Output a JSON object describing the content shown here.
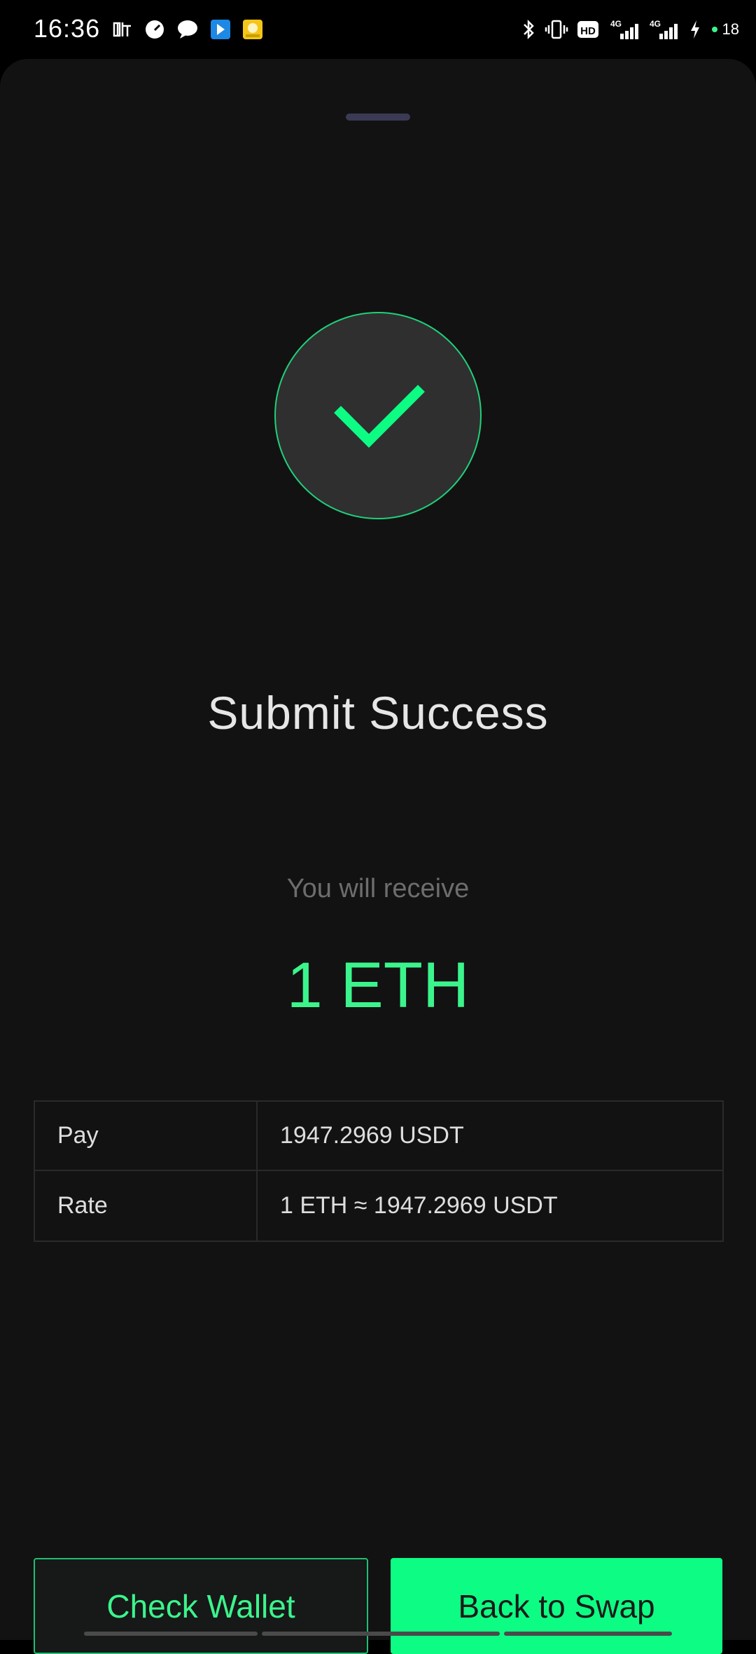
{
  "status_bar": {
    "time": "16:36",
    "battery": "18",
    "network_1": "4G",
    "network_2": "4G",
    "hd_label": "HD"
  },
  "main": {
    "title": "Submit Success",
    "receive_label": "You will receive",
    "receive_amount": "1 ETH"
  },
  "details": [
    {
      "label": "Pay",
      "value": "1947.2969 USDT"
    },
    {
      "label": "Rate",
      "value": "1 ETH ≈ 1947.2969 USDT"
    }
  ],
  "buttons": {
    "check_wallet": "Check Wallet",
    "back_to_swap": "Back to Swap"
  },
  "colors": {
    "accent": "#0dfd84",
    "accent_text": "#3bf58c",
    "background": "#121212"
  }
}
